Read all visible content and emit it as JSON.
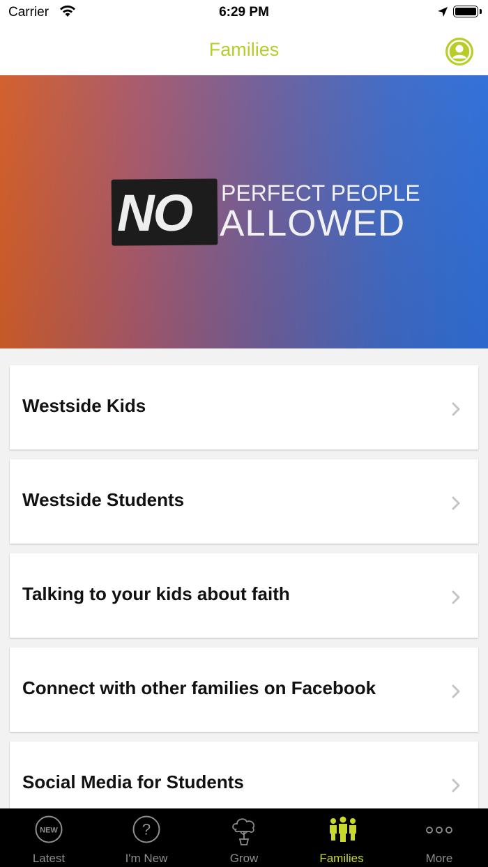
{
  "status_bar": {
    "carrier": "Carrier",
    "time": "6:29 PM"
  },
  "nav": {
    "title": "Families"
  },
  "hero": {
    "word_no": "NO",
    "line1": "PERFECT PEOPLE",
    "line2": "ALLOWED"
  },
  "list": {
    "items": [
      {
        "label": "Westside Kids"
      },
      {
        "label": "Westside Students"
      },
      {
        "label": "Talking to your kids about faith"
      },
      {
        "label": "Connect with other families on Facebook"
      },
      {
        "label": "Social Media for Students"
      }
    ]
  },
  "tabs": {
    "active": "Families",
    "accent_color": "#c9d82c",
    "items": [
      {
        "label": "Latest",
        "icon": "new-badge-icon",
        "badge_text": "NEW"
      },
      {
        "label": "I'm New",
        "icon": "question-icon",
        "badge_text": "?"
      },
      {
        "label": "Grow",
        "icon": "tree-icon"
      },
      {
        "label": "Families",
        "icon": "family-icon"
      },
      {
        "label": "More",
        "icon": "more-icon"
      }
    ]
  },
  "colors": {
    "accent": "#b9cd2a",
    "tab_bar_bg": "#000000",
    "page_bg": "#f2f2f2"
  }
}
